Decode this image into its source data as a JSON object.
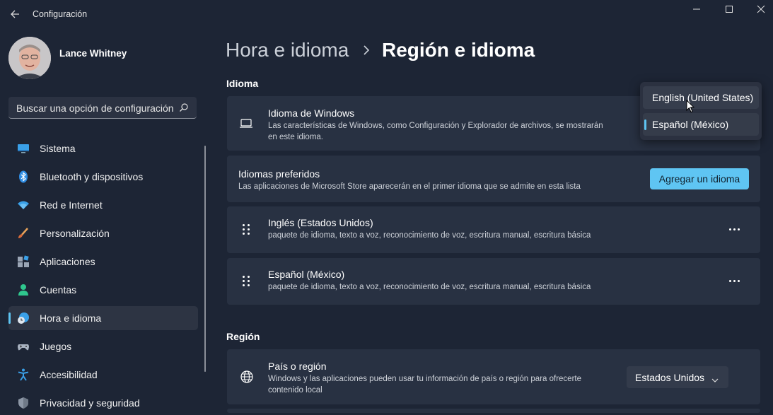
{
  "window": {
    "title": "Configuración"
  },
  "profile": {
    "name": "Lance Whitney"
  },
  "search": {
    "placeholder": "Buscar una opción de configuración"
  },
  "nav": {
    "items": [
      {
        "label": "Sistema",
        "icon": "monitor-icon"
      },
      {
        "label": "Bluetooth y dispositivos",
        "icon": "bluetooth-icon"
      },
      {
        "label": "Red e Internet",
        "icon": "wifi-icon"
      },
      {
        "label": "Personalización",
        "icon": "brush-icon"
      },
      {
        "label": "Aplicaciones",
        "icon": "apps-icon"
      },
      {
        "label": "Cuentas",
        "icon": "person-icon"
      },
      {
        "label": "Hora e idioma",
        "icon": "globe-clock-icon",
        "active": true
      },
      {
        "label": "Juegos",
        "icon": "gamepad-icon"
      },
      {
        "label": "Accesibilidad",
        "icon": "accessibility-icon"
      },
      {
        "label": "Privacidad y seguridad",
        "icon": "shield-icon"
      }
    ]
  },
  "breadcrumb": {
    "parent": "Hora e idioma",
    "current": "Región e idioma"
  },
  "sections": {
    "idioma": "Idioma",
    "region": "Región"
  },
  "windows_language": {
    "title": "Idioma de Windows",
    "desc_line1": "Las características de Windows, como Configuración y Explorador de archivos, se mostrarán",
    "desc_line2": "en este idioma."
  },
  "preferred_languages": {
    "title": "Idiomas preferidos",
    "desc": "Las aplicaciones de Microsoft Store aparecerán en el primer idioma que se admite en esta lista",
    "add_button": "Agregar un idioma"
  },
  "languages": [
    {
      "name": "Inglés (Estados Unidos)",
      "features": "paquete de idioma, texto a voz, reconocimiento de voz, escritura manual, escritura básica"
    },
    {
      "name": "Español (México)",
      "features": "paquete de idioma, texto a voz, reconocimiento de voz, escritura manual, escritura básica"
    }
  ],
  "country": {
    "title": "País o región",
    "desc_line1": "Windows y las aplicaciones pueden usar tu información de país o región para ofrecerte",
    "desc_line2": "contenido local",
    "value": "Estados Unidos"
  },
  "language_dropdown": {
    "options": [
      "English (United States)",
      "Español (México)"
    ],
    "selected": "Español (México)"
  },
  "colors": {
    "background": "#1d2535",
    "card": "#283142",
    "accent": "#5fc5f3"
  }
}
